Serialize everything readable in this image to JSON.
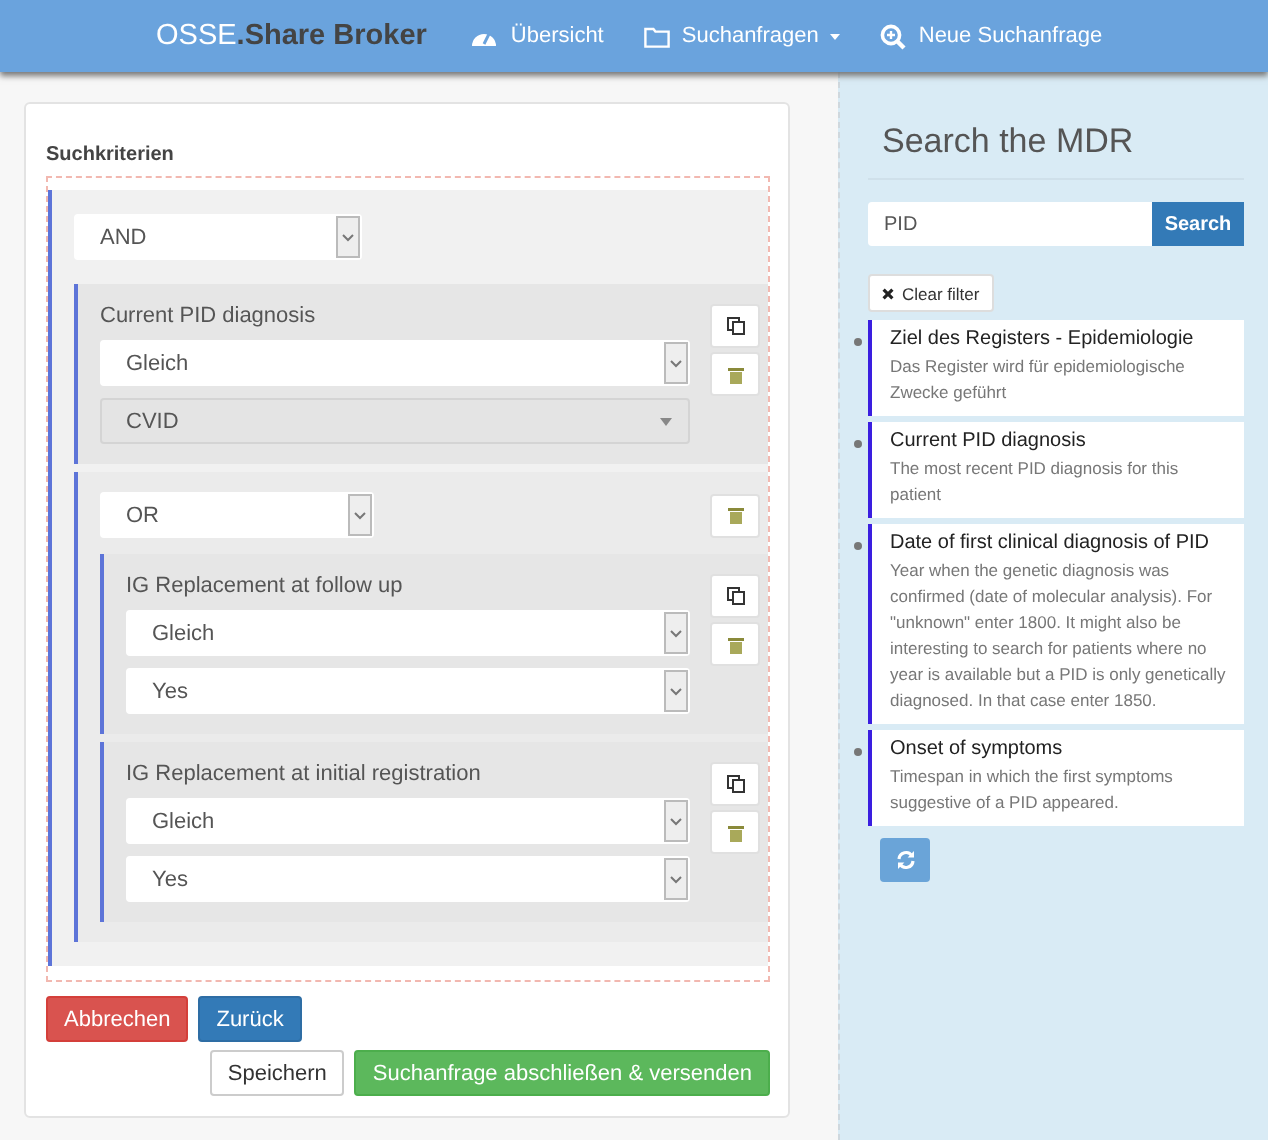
{
  "navbar": {
    "brand_light": "OSSE",
    "brand_dark": ".Share Broker",
    "items": [
      {
        "kind": "dashboard",
        "label": "Übersicht",
        "dropdown": false
      },
      {
        "kind": "folder",
        "label": "Suchanfragen",
        "dropdown": true
      },
      {
        "kind": "search",
        "label": "Neue Suchanfrage",
        "dropdown": false
      }
    ]
  },
  "query": {
    "title": "Suchkriterien",
    "root": {
      "operator": "AND",
      "children": [
        {
          "kind": "criterion",
          "label": "Current PID diagnosis",
          "comparison": "Gleich",
          "value": "CVID",
          "value_disabled": true
        },
        {
          "kind": "group",
          "operator": "OR",
          "children": [
            {
              "kind": "criterion",
              "label": "IG Replacement at follow up",
              "comparison": "Gleich",
              "value": "Yes",
              "value_disabled": false
            },
            {
              "kind": "criterion",
              "label": "IG Replacement at initial registration",
              "comparison": "Gleich",
              "value": "Yes",
              "value_disabled": false
            }
          ]
        }
      ]
    },
    "buttons": [
      {
        "kind": "danger",
        "label": "Abbrechen"
      },
      {
        "kind": "primary",
        "label": "Zurück"
      },
      {
        "kind": "default",
        "label": "Speichern"
      },
      {
        "kind": "success",
        "label": "Suchanfrage abschließen & versenden"
      }
    ]
  },
  "mdr": {
    "title": "Search the MDR",
    "search_value": "PID",
    "search_button": "Search",
    "clear_button": "Clear filter",
    "results": [
      {
        "title": "Ziel des Registers - Epidemiologie",
        "description": "Das Register wird für epidemiologische Zwecke geführt"
      },
      {
        "title": "Current PID diagnosis",
        "description": "The most recent PID diagnosis for this patient"
      },
      {
        "title": "Date of first clinical diagnosis of PID",
        "description": "Year when the genetic diagnosis was confirmed (date of molecular analysis). For \"unknown\" enter 1800. It might also be interesting to search for patients where no year is available but a PID is only genetically diagnosed. In that case enter 1850."
      },
      {
        "title": "Onset of symptoms",
        "description": "Timespan in which the first symptoms suggestive of a PID appeared."
      }
    ]
  }
}
